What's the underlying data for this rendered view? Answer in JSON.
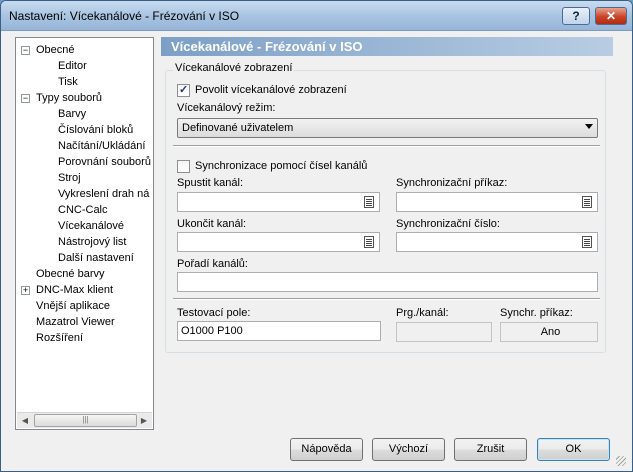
{
  "window": {
    "title": "Nastavení: Vícekanálové - Frézování v ISO",
    "help_label": "?",
    "close_label": "✕"
  },
  "tree": {
    "items": [
      {
        "label": "Obecné",
        "expander": "−"
      },
      {
        "label": "Editor"
      },
      {
        "label": "Tisk"
      },
      {
        "label": "Typy souborů",
        "expander": "−"
      },
      {
        "label": "Barvy"
      },
      {
        "label": "Číslování bloků"
      },
      {
        "label": "Načítání/Ukládání"
      },
      {
        "label": "Porovnání souborů"
      },
      {
        "label": "Stroj"
      },
      {
        "label": "Vykreslení drah ná"
      },
      {
        "label": "CNC-Calc"
      },
      {
        "label": "Vícekanálové"
      },
      {
        "label": "Nástrojový list"
      },
      {
        "label": "Další nastavení"
      },
      {
        "label": "Obecné barvy"
      },
      {
        "label": "DNC-Max klient",
        "expander": "+"
      },
      {
        "label": "Vnější aplikace"
      },
      {
        "label": "Mazatrol Viewer"
      },
      {
        "label": "Rozšíření"
      }
    ],
    "scroll_left": "◀",
    "scroll_right": "▶",
    "scroll_grip": "|||"
  },
  "panel": {
    "header": "Vícekanálové - Frézování v ISO",
    "group_title": "Vícekanálové zobrazení",
    "enable_label": "Povolit vícekanálové zobrazení",
    "enable_checked": true,
    "mode_label": "Vícekanálový režim:",
    "mode_value": "Definované uživatelem",
    "sync_label": "Synchronizace pomocí čísel kanálů",
    "sync_checked": false,
    "start_channel_label": "Spustit kanál:",
    "start_channel_value": "",
    "sync_command_label": "Synchronizační příkaz:",
    "sync_command_value": "",
    "end_channel_label": "Ukončit kanál:",
    "end_channel_value": "",
    "sync_number_label": "Synchronizační číslo:",
    "sync_number_value": "",
    "channel_order_label": "Pořadí kanálů:",
    "channel_order_value": "",
    "test_field_label": "Testovací pole:",
    "test_field_value": "O1000 P100",
    "prg_channel_label": "Prg./kanál:",
    "prg_channel_value": "",
    "sync_cmd_result_label": "Synchr. příkaz:",
    "sync_cmd_result_value": "Ano"
  },
  "buttons": {
    "help": "Nápověda",
    "restore": "Výchozí",
    "cancel": "Zrušit",
    "ok": "OK"
  }
}
